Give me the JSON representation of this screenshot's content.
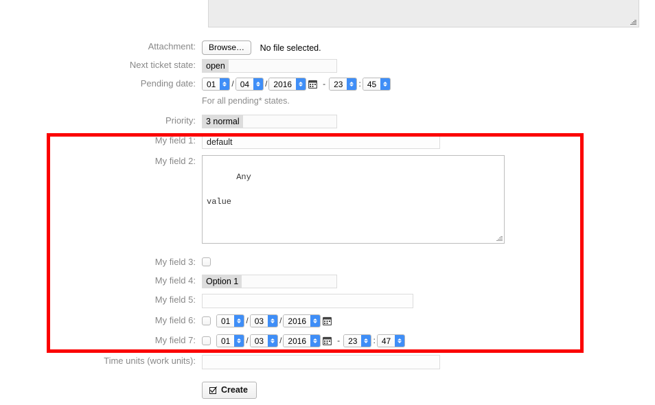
{
  "form": {
    "body_editor": {
      "name": "rich-text-body",
      "resize_handle": "resize-grip"
    },
    "attachment": {
      "label": "Attachment:",
      "browse_label": "Browse…",
      "file_status": "No file selected."
    },
    "next_ticket_state": {
      "label": "Next ticket state:",
      "value": "open"
    },
    "pending_date": {
      "label": "Pending date:",
      "day": "01",
      "month": "04",
      "year": "2016",
      "hour": "23",
      "minute": "45",
      "date_sep": "/",
      "time_sep": ":",
      "range_sep": "-",
      "calendar_icon": "calendar-icon",
      "helper": "For all pending* states."
    },
    "priority": {
      "label": "Priority:",
      "value": "3 normal"
    },
    "my_field_1": {
      "label": "My field 1:",
      "value": "default"
    },
    "my_field_2": {
      "label": "My field 2:",
      "value": "Any\n\nvalue"
    },
    "my_field_3": {
      "label": "My field 3:",
      "checked": false
    },
    "my_field_4": {
      "label": "My field 4:",
      "value": "Option 1"
    },
    "my_field_5": {
      "label": "My field 5:",
      "value": ""
    },
    "my_field_6": {
      "label": "My field 6:",
      "checked": false,
      "day": "01",
      "month": "03",
      "year": "2016",
      "date_sep": "/",
      "calendar_icon": "calendar-icon"
    },
    "my_field_7": {
      "label": "My field 7:",
      "checked": false,
      "day": "01",
      "month": "03",
      "year": "2016",
      "hour": "23",
      "minute": "47",
      "date_sep": "/",
      "time_sep": ":",
      "range_sep": "-",
      "calendar_icon": "calendar-icon"
    },
    "time_units": {
      "label": "Time units (work units):",
      "value": ""
    },
    "submit": {
      "label": "Create",
      "icon": "checked-box-icon"
    }
  },
  "annotation": {
    "highlight": {
      "name": "red-highlight-box",
      "color": "#fb0000",
      "covers": "My field 1 through My field 7"
    }
  }
}
